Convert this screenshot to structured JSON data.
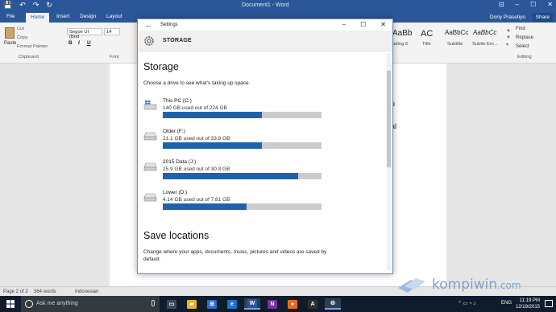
{
  "word": {
    "quick_access": [
      "💾",
      "↶",
      "↷",
      "↻"
    ],
    "doc_title": "Document1 - Word",
    "window_controls": [
      "⊡",
      "–",
      "☐",
      "✕"
    ],
    "tabs": [
      "File",
      "Home",
      "Insert",
      "Design",
      "Layout"
    ],
    "user": "Dony Prasetiyo",
    "share": "Share",
    "ribbon": {
      "paste": "Paste",
      "cut": "Cut",
      "copy": "Copy",
      "format_painter": "Format Painter",
      "clipboard_group": "Clipboard",
      "font_name": "Segoe UI (Bod",
      "font_size": "14",
      "font_group": "Font",
      "bold": "B",
      "italic": "I",
      "underline": "U",
      "styles": [
        {
          "sample": "AaBb",
          "name": "ading 3"
        },
        {
          "sample": "AC",
          "name": "Title"
        },
        {
          "sample": "AaBbCc",
          "name": "Subtitle"
        },
        {
          "sample": "AaBbCc",
          "name": "Subtle Em..."
        }
      ],
      "find": "Find",
      "replace": "Replace",
      "select": "Select",
      "editing_group": "Editing"
    },
    "doc_fragments": [
      "u",
      "al"
    ],
    "status": {
      "page": "Page 2 of 2",
      "words": "364 words",
      "language": "Indonesian"
    }
  },
  "settings": {
    "title": "Settings",
    "back_glyph": "←",
    "header": "STORAGE",
    "heading": "Storage",
    "subtitle": "Choose a drive to see what's taking up space.",
    "drives": [
      {
        "name": "This PC (C:)",
        "usage": "140 GB used out of 224 GB",
        "used": 140,
        "total": 224,
        "icon": "windows-drive-icon"
      },
      {
        "name": "Older (F:)",
        "usage": "21.1 GB used out of 33.8 GB",
        "used": 21.1,
        "total": 33.8,
        "icon": "drive-icon"
      },
      {
        "name": "2015 Data (J:)",
        "usage": "25.9 GB used out of 30.3 GB",
        "used": 25.9,
        "total": 30.3,
        "icon": "drive-icon"
      },
      {
        "name": "Lower (D:)",
        "usage": "4.14 GB used out of 7.81 GB",
        "used": 4.14,
        "total": 7.81,
        "icon": "drive-icon"
      }
    ],
    "save_heading": "Save locations",
    "save_desc": "Change where your apps, documents, music, pictures and videos are saved by default.",
    "bar_fill_color": "#1e62ac",
    "bar_track_color": "#cccccc"
  },
  "taskbar": {
    "search_placeholder": "Ask me anything",
    "apps": [
      {
        "name": "task-view",
        "glyph": "▭",
        "color": "#3a4a5e"
      },
      {
        "name": "file-explorer",
        "glyph": "▰",
        "color": "#e8b32a"
      },
      {
        "name": "store",
        "glyph": "⊞",
        "color": "#2b6cc4"
      },
      {
        "name": "edge",
        "glyph": "e",
        "color": "#1e73c8"
      },
      {
        "name": "word",
        "glyph": "W",
        "color": "#2b579a"
      },
      {
        "name": "onenote",
        "glyph": "N",
        "color": "#7b2fa4"
      },
      {
        "name": "firefox",
        "glyph": "●",
        "color": "#e86b1f"
      },
      {
        "name": "app",
        "glyph": "A",
        "color": "#2f2f2f"
      },
      {
        "name": "settings",
        "glyph": "⚙",
        "color": "#2c3d55"
      }
    ],
    "tray_lang": "ENG",
    "time": "11:19 PM",
    "date": "12/19/2015"
  },
  "watermark": "kompiwin",
  "watermark_tld": ".com"
}
